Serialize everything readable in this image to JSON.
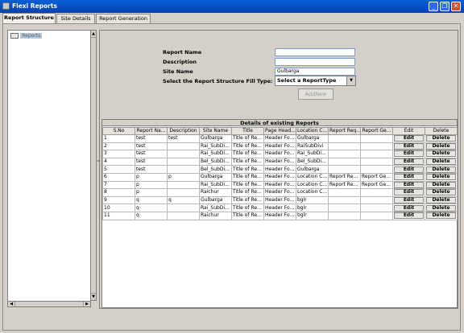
{
  "window": {
    "title": "Flexi Reports",
    "minimize_label": "_",
    "maximize_label": "❐",
    "close_label": "✕"
  },
  "tabs": [
    {
      "label": "Report Structure",
      "active": true
    },
    {
      "label": "Site Details",
      "active": false
    },
    {
      "label": "Report Generation",
      "active": false
    }
  ],
  "tree": {
    "root_label": "Reports"
  },
  "form": {
    "report_name_label": "Report Name",
    "report_name_value": "",
    "description_label": "Description",
    "description_value": "",
    "site_name_label": "Site Name",
    "site_name_value": "Gulbarga",
    "fill_type_label": "Select the Report Structure Fill Type:",
    "fill_type_value": "Select a ReportType",
    "add_new_label": "AddNew"
  },
  "grid": {
    "title": "Details of existing Reports",
    "columns": [
      "S.No",
      "Report Na...",
      "Description",
      "Site Name",
      "Title",
      "Page Head...",
      "Location C...",
      "Report Req...",
      "Report Ge...",
      "Edit",
      "Delete"
    ],
    "edit_label": "Edit",
    "delete_label": "Delete",
    "rows": [
      [
        "1",
        "test",
        "test",
        "Gulbarga",
        "Title of Re...",
        "Header Fo...",
        "Gulbarga",
        "",
        ""
      ],
      [
        "2",
        "test",
        "",
        "Rai_SubDi...",
        "Title of Re...",
        "Header Fo...",
        "RaiSubDivi",
        "",
        ""
      ],
      [
        "3",
        "test",
        "",
        "Rai_SubDi...",
        "Title of Re...",
        "Header Fo...",
        "Rai_SubDi...",
        "",
        ""
      ],
      [
        "4",
        "test",
        "",
        "Bel_SubDi...",
        "Title of Re...",
        "Header Fo...",
        "Bel_SubDi...",
        "",
        ""
      ],
      [
        "5",
        "test",
        "",
        "Bel_SubDi...",
        "Title of Re...",
        "Header Fo...",
        "Gulbarga",
        "",
        ""
      ],
      [
        "6",
        "p",
        "p",
        "Gulbarga",
        "Title of Re...",
        "Header Fo...",
        "Location C...",
        "Report Re...",
        "Report Ge..."
      ],
      [
        "7",
        "p",
        "",
        "Rai_SubDi...",
        "Title of Re...",
        "Header Fo...",
        "Location C...",
        "Report Re...",
        "Report Ge..."
      ],
      [
        "8",
        "p",
        "",
        "Raichur",
        "Title of Re...",
        "Header Fo...",
        "Location C...",
        "",
        ""
      ],
      [
        "9",
        "q",
        "q",
        "Gulbarga",
        "Title of Re...",
        "Header Fo...",
        "bglr",
        "",
        ""
      ],
      [
        "10",
        "q",
        "",
        "Rai_SubDi...",
        "Title of Re...",
        "Header Fo...",
        "bglr",
        "",
        ""
      ],
      [
        "11",
        "q",
        "",
        "Raichur",
        "Title of Re...",
        "Header Fo...",
        "bglr",
        "",
        ""
      ]
    ]
  },
  "scroll": {
    "up": "▲",
    "down": "▼",
    "left": "◀",
    "right": "▶"
  }
}
